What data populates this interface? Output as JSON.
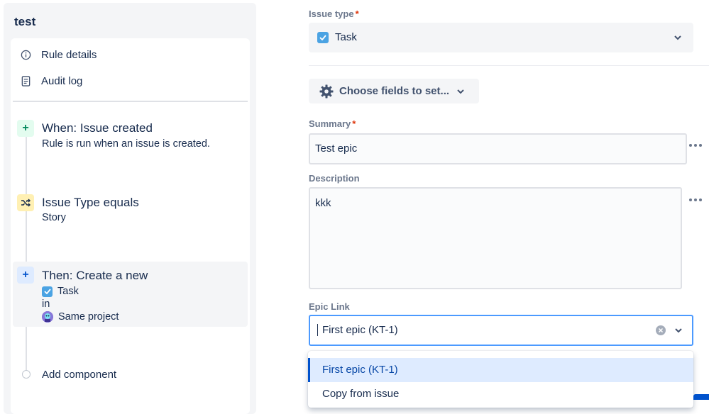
{
  "rule": {
    "title": "test",
    "menu": [
      {
        "label": "Rule details",
        "icon": "info-icon"
      },
      {
        "label": "Audit log",
        "icon": "document-icon"
      }
    ],
    "steps": {
      "trigger": {
        "title": "When: Issue created",
        "subtitle": "Rule is run when an issue is created.",
        "icon": "plus-icon",
        "color": "#e3fcef"
      },
      "condition": {
        "title": "Issue Type equals",
        "subtitle": "Story",
        "icon": "shuffle-icon",
        "color": "#fff0b3"
      },
      "action": {
        "title": "Then: Create a new",
        "type": "Task",
        "in": "in",
        "project": "Same project",
        "icon": "plus-icon",
        "color": "#deebff"
      }
    },
    "add_component": "Add component"
  },
  "form": {
    "issue_type": {
      "label": "Issue type",
      "required": "*",
      "value": "Task"
    },
    "choose_fields": "Choose fields to set...",
    "summary": {
      "label": "Summary",
      "required": "*",
      "value": "Test epic"
    },
    "description": {
      "label": "Description",
      "value": "kkk"
    },
    "epic_link": {
      "label": "Epic Link",
      "value": "First epic (KT-1)",
      "options": [
        "First epic (KT-1)",
        "Copy from issue"
      ]
    }
  },
  "colors": {
    "accent": "#0052cc",
    "focus": "#4c9aff",
    "task": "#4ba3e3",
    "required": "#de350b"
  }
}
